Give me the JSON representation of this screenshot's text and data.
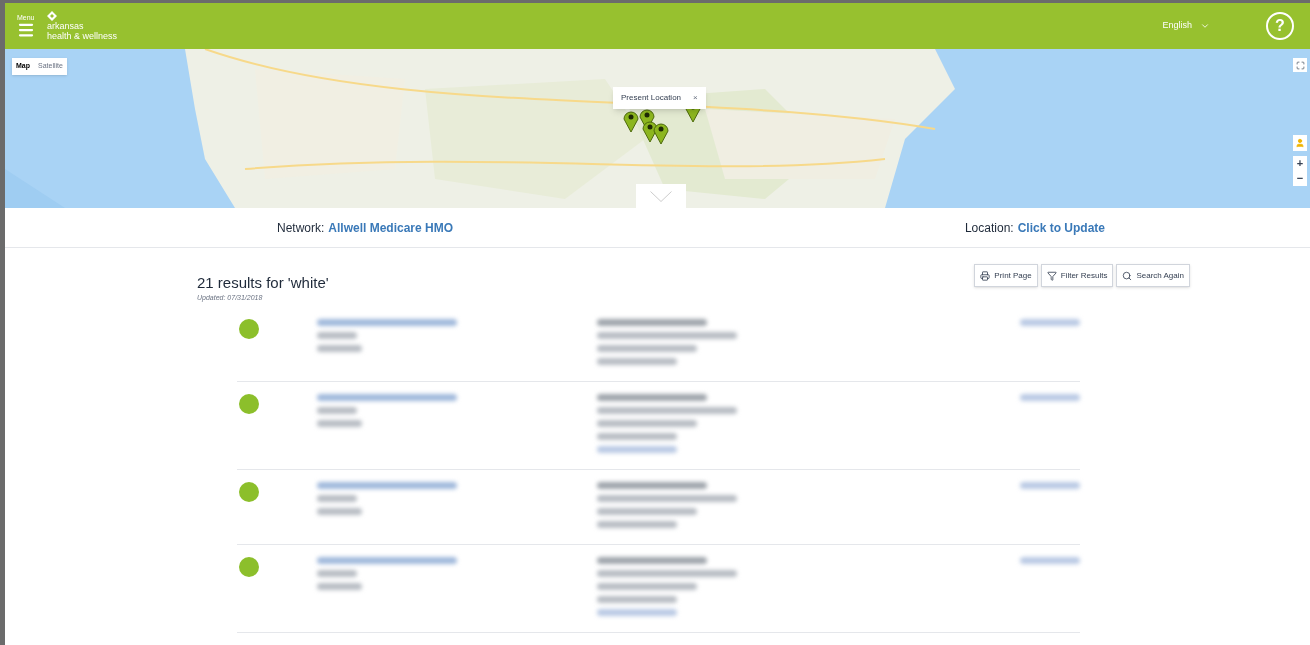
{
  "header": {
    "menu_label": "Menu",
    "brand": [
      "arkansas",
      "health & wellness"
    ],
    "language": "English",
    "help": "?"
  },
  "map": {
    "type_tabs": [
      {
        "label": "Map",
        "selected": true
      },
      {
        "label": "Satellite",
        "selected": false
      }
    ],
    "popup": {
      "text": "Present Location",
      "close": "×"
    },
    "zoom_in": "+",
    "zoom_out": "−"
  },
  "network": {
    "label": "Network:",
    "value": "Allwell Medicare HMO"
  },
  "location": {
    "label": "Location:",
    "value": "Click to Update"
  },
  "results": {
    "title": "21 results for 'white'",
    "updated": "Updated: 07/31/2018",
    "actions": [
      {
        "kind": "print",
        "label": "Print Page"
      },
      {
        "kind": "filter",
        "label": "Filter Results"
      },
      {
        "kind": "search",
        "label": "Search Again"
      }
    ],
    "items": [
      {
        "kind": "blurred",
        "extra_link": false
      },
      {
        "kind": "blurred",
        "extra_link": true
      },
      {
        "kind": "blurred",
        "extra_link": false
      },
      {
        "kind": "blurred",
        "extra_link": true
      }
    ]
  }
}
